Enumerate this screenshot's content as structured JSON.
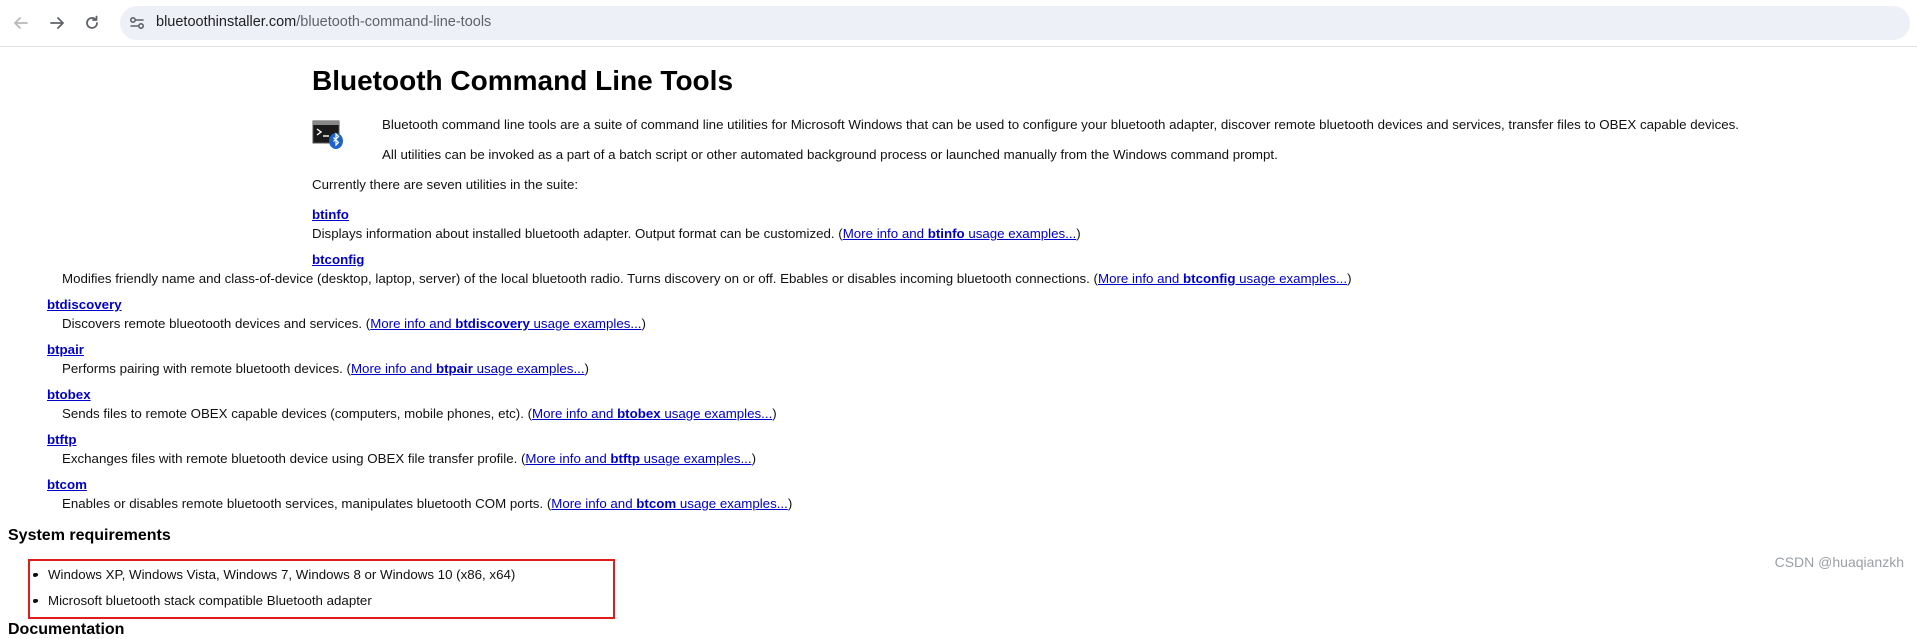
{
  "browser": {
    "url_host": "bluetoothinstaller.com",
    "url_path": "/bluetooth-command-line-tools",
    "icons": {
      "back": "arrow-left-icon",
      "forward": "arrow-right-icon",
      "reload": "reload-icon",
      "site_info": "tune-icon"
    }
  },
  "page": {
    "title": "Bluetooth Command Line Tools",
    "intro": "Bluetooth command line tools are a suite of command line utilities for Microsoft Windows that can be used to configure your bluetooth adapter, discover remote bluetooth devices and services, transfer files to OBEX capable devices.",
    "intro2": "All utilities can be invoked as a part of a batch script or other automated background process or launched manually from the Windows command prompt.",
    "suite_text": "Currently there are seven utilities in the suite:",
    "more_prefix": "More info and ",
    "more_suffix": " usage examples...",
    "tools": [
      {
        "name": "btinfo",
        "desc": "Displays information about installed bluetooth adapter. Output format can be customized. ("
      },
      {
        "name": "btconfig",
        "desc": "Modifies friendly name and class-of-device (desktop, laptop, server) of the local bluetooth radio. Turns discovery on or off. Ebables or disables incoming bluetooth connections. ("
      },
      {
        "name": "btdiscovery",
        "desc": "Discovers remote blueotooth devices and services. ("
      },
      {
        "name": "btpair",
        "desc": "Performs pairing with remote bluetooth devices. ("
      },
      {
        "name": "btobex",
        "desc": "Sends files to remote OBEX capable devices (computers, mobile phones, etc). ("
      },
      {
        "name": "btftp",
        "desc": "Exchanges files with remote bluetooth device using OBEX file transfer profile. ("
      },
      {
        "name": "btcom",
        "desc": "Enables or disables remote bluetooth services, manipulates bluetooth COM ports. ("
      }
    ],
    "close_paren": ")",
    "system_requirements": {
      "heading": "System requirements",
      "items": [
        "Windows XP, Windows Vista, Windows 7, Windows 8 or Windows 10 (x86, x64)",
        "Microsoft bluetooth stack compatible Bluetooth adapter"
      ],
      "highlight_color": "#e21c1c"
    },
    "next_heading": "Documentation"
  },
  "watermark": "CSDN @huaqianzkh",
  "colors": {
    "link": "#0000cc",
    "omnibox": "#eef0f8"
  }
}
